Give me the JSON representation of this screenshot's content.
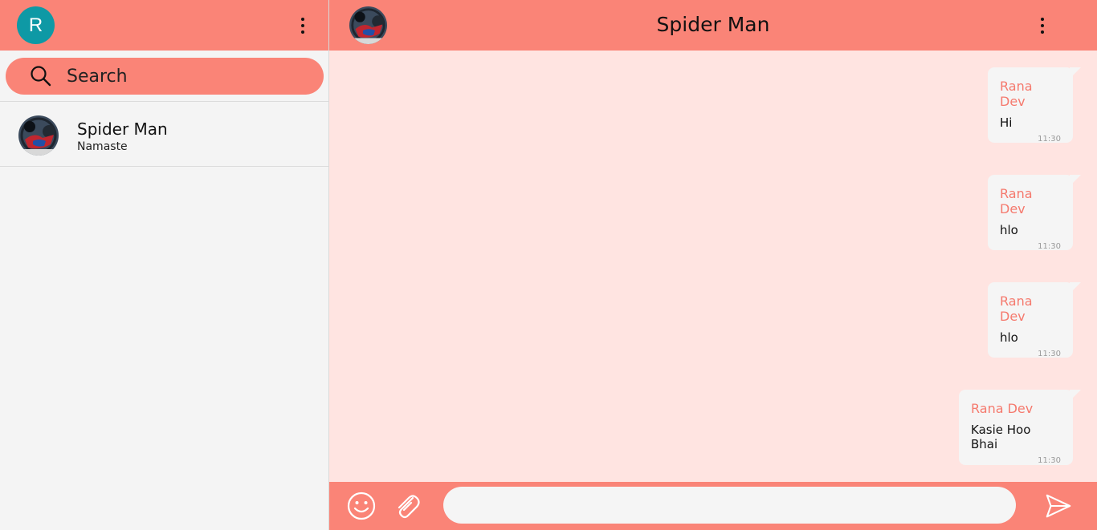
{
  "current_user": {
    "initial": "R"
  },
  "search": {
    "placeholder": "Search"
  },
  "chats": [
    {
      "name": "Spider Man",
      "preview": "Namaste"
    }
  ],
  "active_chat": {
    "title": "Spider Man"
  },
  "messages": [
    {
      "sender": "Rana Dev",
      "text": "Hi",
      "time": "11:30"
    },
    {
      "sender": "Rana Dev",
      "text": "hlo",
      "time": "11:30"
    },
    {
      "sender": "Rana Dev",
      "text": "hlo",
      "time": "11:30"
    },
    {
      "sender": "Rana Dev",
      "text": "Kasie Hoo Bhai",
      "time": "11:30"
    }
  ],
  "composer": {
    "value": ""
  },
  "icons": {
    "menu": "kebab-menu-icon",
    "search": "search-icon",
    "emoji": "emoji-icon",
    "attach": "paperclip-icon",
    "send": "send-icon"
  },
  "colors": {
    "accent": "#fa8477",
    "chat_background": "#ffe4e1",
    "sender_name": "#f57a6e",
    "user_avatar": "#0e99a5"
  }
}
